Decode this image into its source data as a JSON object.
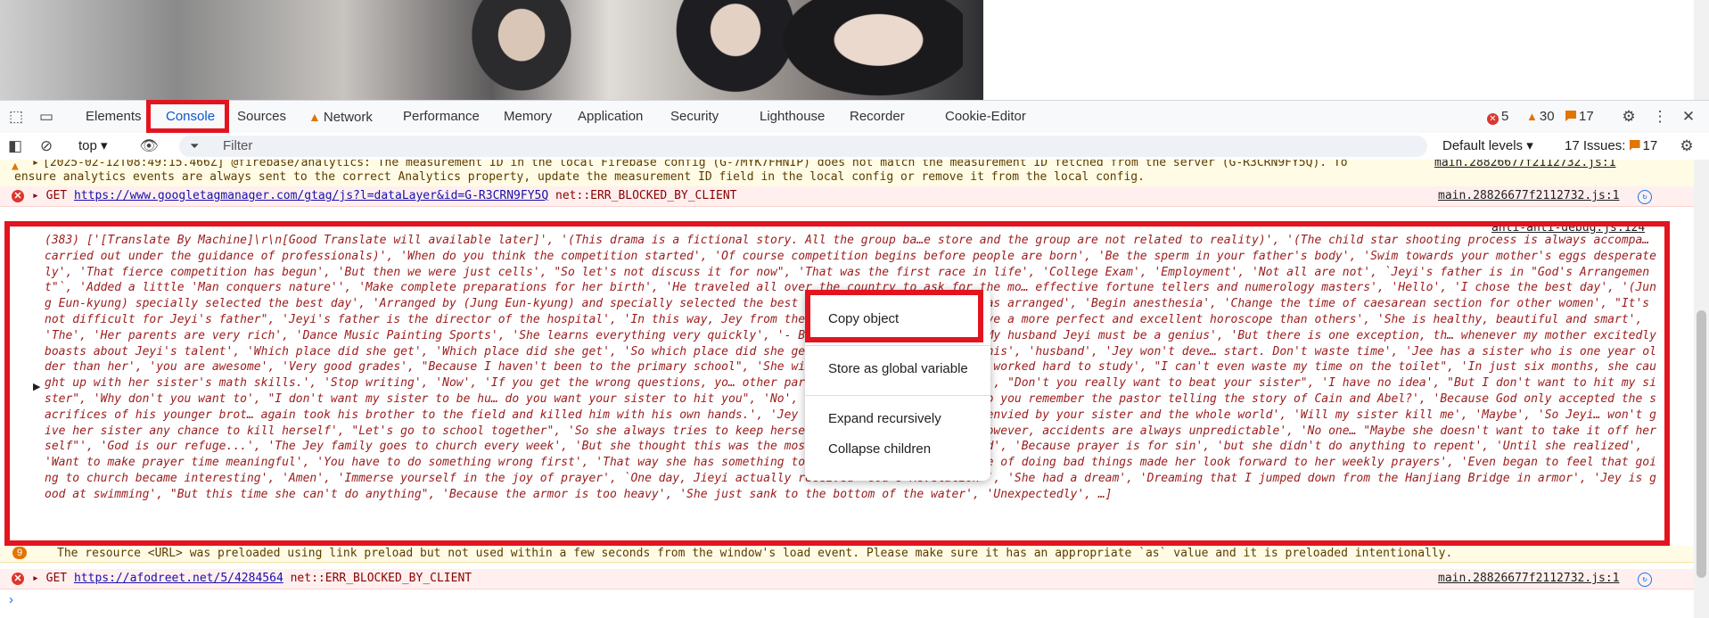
{
  "devtools": {
    "tabs": [
      {
        "label": "Elements"
      },
      {
        "label": "Console"
      },
      {
        "label": "Sources"
      },
      {
        "label": "Network"
      },
      {
        "label": "Performance"
      },
      {
        "label": "Memory"
      },
      {
        "label": "Application"
      },
      {
        "label": "Security"
      },
      {
        "label": "Lighthouse"
      },
      {
        "label": "Recorder"
      },
      {
        "label": "Cookie-Editor"
      }
    ],
    "counts": {
      "errors": "5",
      "warnings": "30",
      "issues": "17"
    }
  },
  "console_toolbar": {
    "context": "top",
    "filter_placeholder": "Filter",
    "levels": "Default levels",
    "issues_label": "17 Issues:",
    "issues_count": "17"
  },
  "messages": {
    "firebase_warn": {
      "line1": "[2025-02-12T08:49:15.466Z]  @firebase/analytics: The measurement ID in the local Firebase config (G-7MYK7FHNIP) does not match the measurement ID fetched from the server (G-R3CRN9FY5Q). To",
      "line2": "ensure analytics events are always sent to the correct Analytics property, update the measurement ID field in the local config or remove it from the local config.",
      "source": "main.28826677f2112732.js:1"
    },
    "gtag_err": {
      "method": "GET",
      "url": "https://www.googletagmanager.com/gtag/js?l=dataLayer&id=G-R3CRN9FY5Q",
      "error": "net::ERR_BLOCKED_BY_CLIENT",
      "source": "main.28826677f2112732.js:1"
    },
    "array_log": {
      "source": "anti-anti-debug.js:124",
      "text": "(383) ['[Translate By Machine]\\r\\n[Good Translate will available later]', '(This drama is a fictional story. All the group ba…e store and the group are not related to reality)', '(The child star shooting process is always accompa… carried out under the guidance of professionals)', 'When do you think the competition started', 'Of course competition begins before people are born', 'Be the sperm in your father's body', 'Swim towards your mother's eggs desperately', 'That fierce competition has begun', 'But then we were just cells', \"So let's not discuss it for now\", 'That was the first race in life', 'College Exam', 'Employment', 'Not all are not', `Jeyi's father is in \"God's Arrangement\"`, 'Added a little 'Man conquers nature'', 'Make complete preparations for her birth', 'He traveled all over the country to ask for the mo… effective fortune tellers and numerology masters', 'Hello', 'I chose the best day', '(Jung Eun-kyung) specially selected the best day', 'Arranged by (Jung Eun-kyung) and specially selected the best day', 'Caesarean section was arranged', 'Begin anesthesia', 'Change the time of caesarean section for other women', \"It's not difficult for Jeyi's father\", 'Jeyi's father is the director of the hospital', 'In this way, Jey from the moment she was born', 'Have a more perfect and excellent horoscope than others', 'She is healthy, beautiful and smart', 'The', 'Her parents are very rich', 'Dance Music Painting Sports', 'She learns everything very quickly', '- Being praised everywhere - My husband Jeyi must be a genius', 'But there is one exception, th… whenever my mother excitedly boasts about Jeyi's talent', 'Which place did she get', 'Which place did she get', 'So which place did she get', 'He always asks only this', 'husband', 'Jey won't deve… start. Don't waste time', 'Jee has a sister who is one year older than her', 'you are awesome', 'Very good grades', \"Because I haven't been to the primary school\", 'She will solve the math problem… worked hard to study', \"I can't even waste my time on the toilet\", 'In just six months, she caught up with her sister's math skills.', 'Stop writing', 'Now', 'If you get the wrong questions, yo… other party a few times.', 'Why cry', \"Don't you really want to beat your sister\", 'I have no idea', \"But I don't want to hit my sister\", 'Why don't you want to', \"I don't want my sister to be hu… do you want your sister to hit you\", 'No', \"Don't want it\", 'Jey', 'Do you remember the pastor telling the story of Cain and Abel?', 'Because God only accepted the sacrifices of his younger brot… again took his brother to the field and killed him with his own hands.', 'Jey starts now', 'You will be envied by your sister and the whole world', 'Will my sister kill me', 'Maybe', 'So Jeyi… won't give her sister any chance to kill herself', \"Let's go to school together\", 'So she always tries to keep herself away from everyone', 'However, accidents are always unpredictable', 'No one… \"Maybe she doesn't want to take it off herself\"', 'God is our refuge...', 'The Jey family goes to church every week', 'But she thought this was the most boring thing in the world', 'Because prayer is for sin', 'but she didn't do anything to repent', 'Until she realized', 'Want to make prayer time meaningful', 'You have to do something wrong first', 'That way she has something to say to God', 'The pleasure of doing bad things made her look forward to her weekly prayers', 'Even began to feel that going to church became interesting', 'Amen', 'Immerse yourself in the joy of prayer', `One day, Jieyi actually received \"God's Revelation\"`, 'She had a dream', 'Dreaming that I jumped down from the Hanjiang Bridge in armor', 'Jey is good at swimming', \"But this time she can't do anything\", 'Because the armor is too heavy', 'She just sank to the bottom of the water', 'Unexpectedly', …]"
    },
    "preload_warn": {
      "count": "9",
      "text": "The resource <URL> was preloaded using link preload but not used within a few seconds from the window's load event. Please make sure it has an appropriate `as` value and it is preloaded intentionally."
    },
    "afod_err": {
      "method": "GET",
      "url": "https://afodreet.net/5/4284564",
      "error": "net::ERR_BLOCKED_BY_CLIENT",
      "source": "main.28826677f2112732.js:1"
    }
  },
  "context_menu": {
    "items": [
      "Copy object",
      "Store as global variable",
      "Expand recursively",
      "Collapse children"
    ]
  }
}
